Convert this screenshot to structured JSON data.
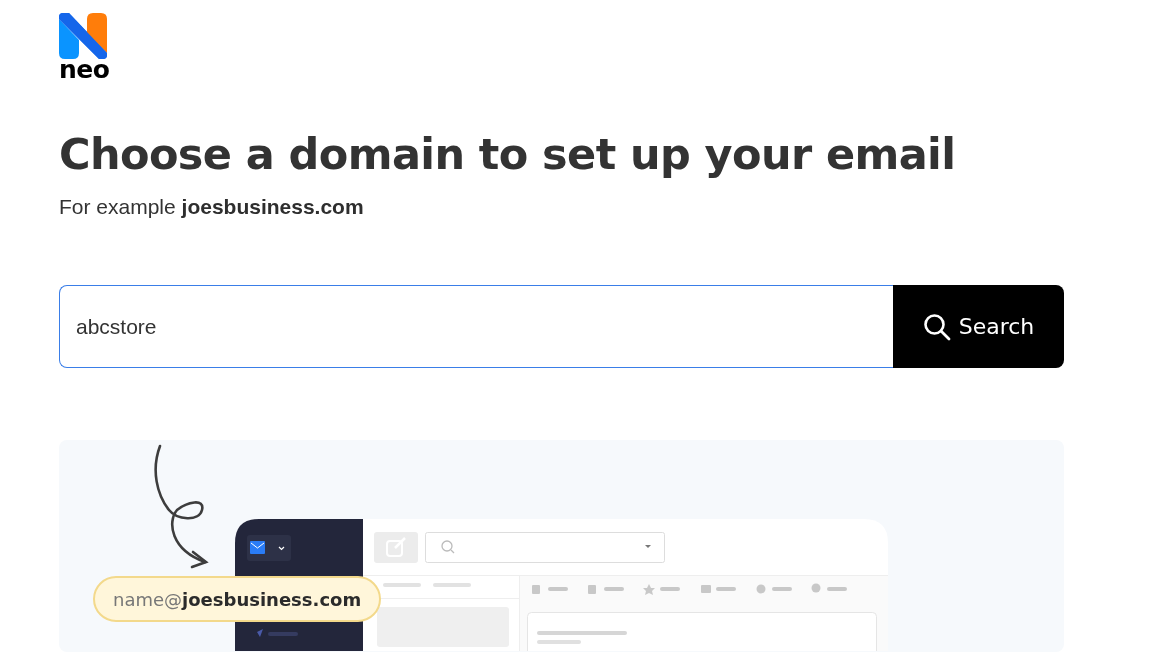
{
  "logo": {
    "wordmark": "neo"
  },
  "heading": "Choose a domain to set up your email",
  "subheading": "For example **joesbusiness.com**",
  "search": {
    "value": "abcstore",
    "button": "Search"
  },
  "illustration": {
    "email_pill": "name@**joesbusiness.com**"
  }
}
